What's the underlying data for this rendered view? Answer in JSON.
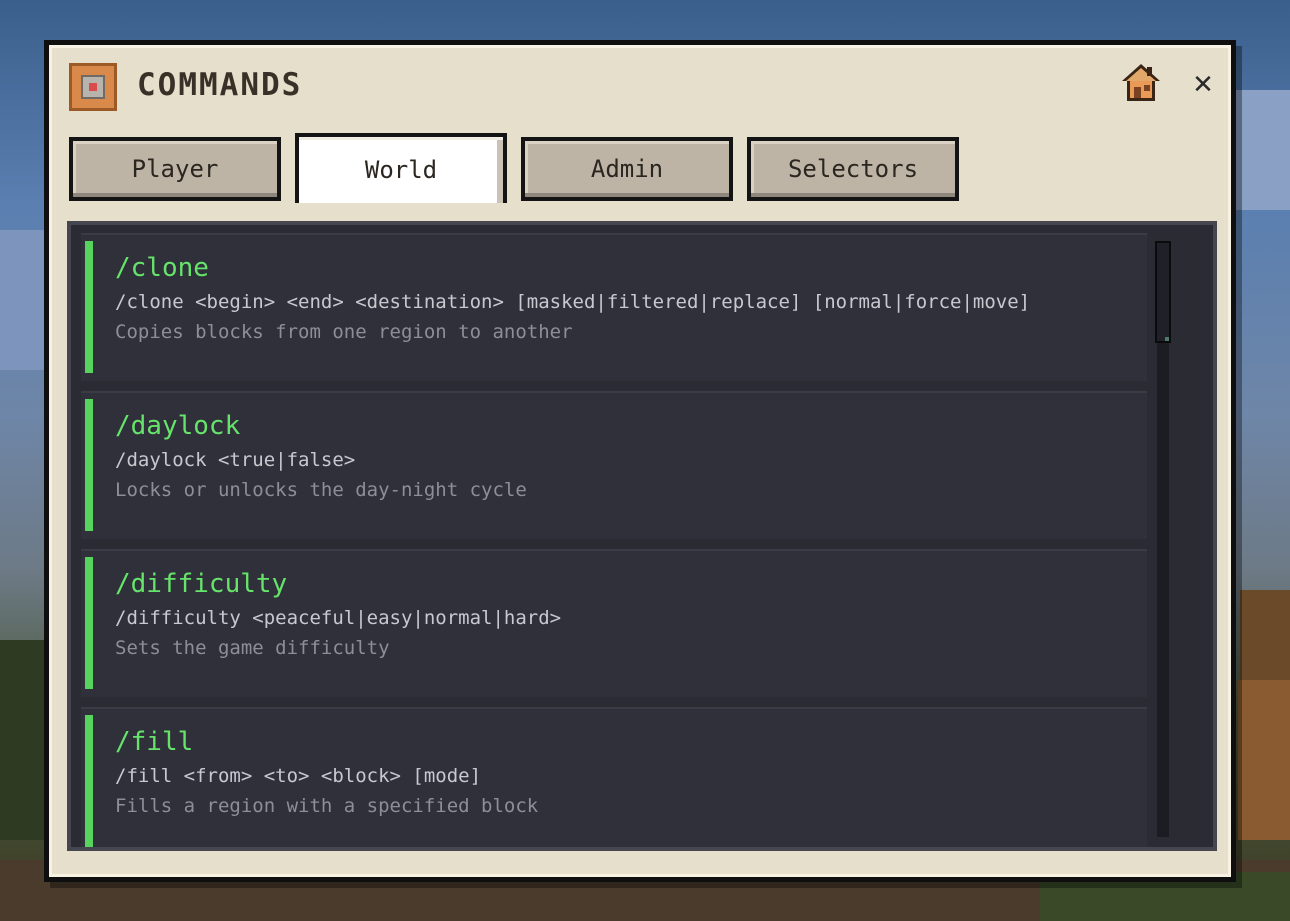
{
  "window": {
    "title": "COMMANDS",
    "icons": {
      "app": "command-block-icon",
      "home": "house-icon",
      "close": "close-icon"
    },
    "close_glyph": "✕"
  },
  "tabs": [
    {
      "label": "Player",
      "active": false
    },
    {
      "label": "World",
      "active": true
    },
    {
      "label": "Admin",
      "active": false
    },
    {
      "label": "Selectors",
      "active": false
    }
  ],
  "commands": [
    {
      "name": "/clone",
      "usage": "/clone <begin> <end> <destination> [masked|filtered|replace] [normal|force|move]",
      "description": "Copies blocks from one region to another"
    },
    {
      "name": "/daylock",
      "usage": "/daylock <true|false>",
      "description": "Locks or unlocks the day-night cycle"
    },
    {
      "name": "/difficulty",
      "usage": "/difficulty <peaceful|easy|normal|hard>",
      "description": "Sets the game difficulty"
    },
    {
      "name": "/fill",
      "usage": "/fill <from> <to> <block> [mode]",
      "description": "Fills a region with a specified block"
    }
  ],
  "colors": {
    "accent": "#57d45e",
    "command_name": "#66e36a",
    "panel_bg": "#2a2b33",
    "window_bg": "#e6dfcb"
  }
}
